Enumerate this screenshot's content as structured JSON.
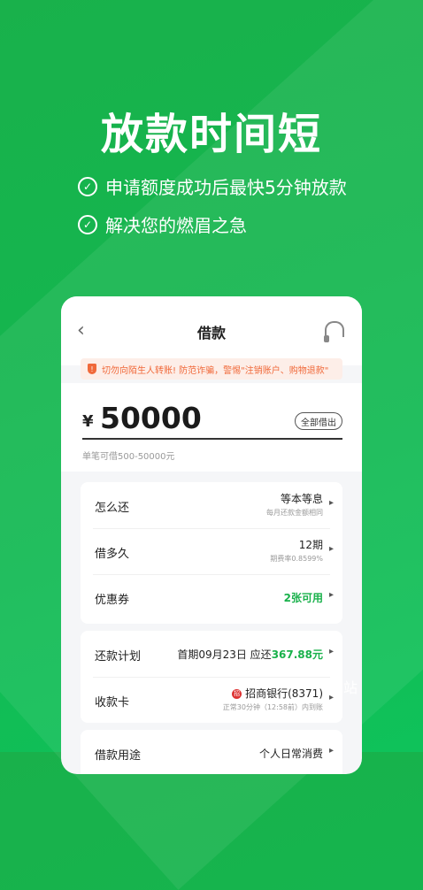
{
  "headline": "放款时间短",
  "features": [
    "申请额度成功后最快5分钟放款",
    "解决您的燃眉之急"
  ],
  "phone": {
    "title": "借款",
    "warning": "切勿向陌生人转账! 防范诈骗，警惕\"注销账户、购物退款\"",
    "currency": "¥",
    "amount": "50000",
    "all_button": "全部借出",
    "range_text": "单笔可借500-50000元",
    "repay_method": {
      "label": "怎么还",
      "value": "等本等息",
      "sub": "每月还款金额相同"
    },
    "term": {
      "label": "借多久",
      "value": "12期",
      "sub": "期费率0.8599%"
    },
    "coupon": {
      "label": "优惠券",
      "value": "2张可用"
    },
    "plan": {
      "label": "还款计划",
      "prefix": "首期09月23日 应还",
      "amount": "367.88元"
    },
    "card": {
      "label": "收款卡",
      "bank": "招商银行(8371)",
      "sub": "正常30分钟（12:58前）内到账"
    },
    "purpose": {
      "label": "借款用途",
      "value": "个人日常消费"
    }
  },
  "watermark": "站",
  "colors": {
    "brand_green": "#19b14b",
    "warning": "#f0693a"
  }
}
